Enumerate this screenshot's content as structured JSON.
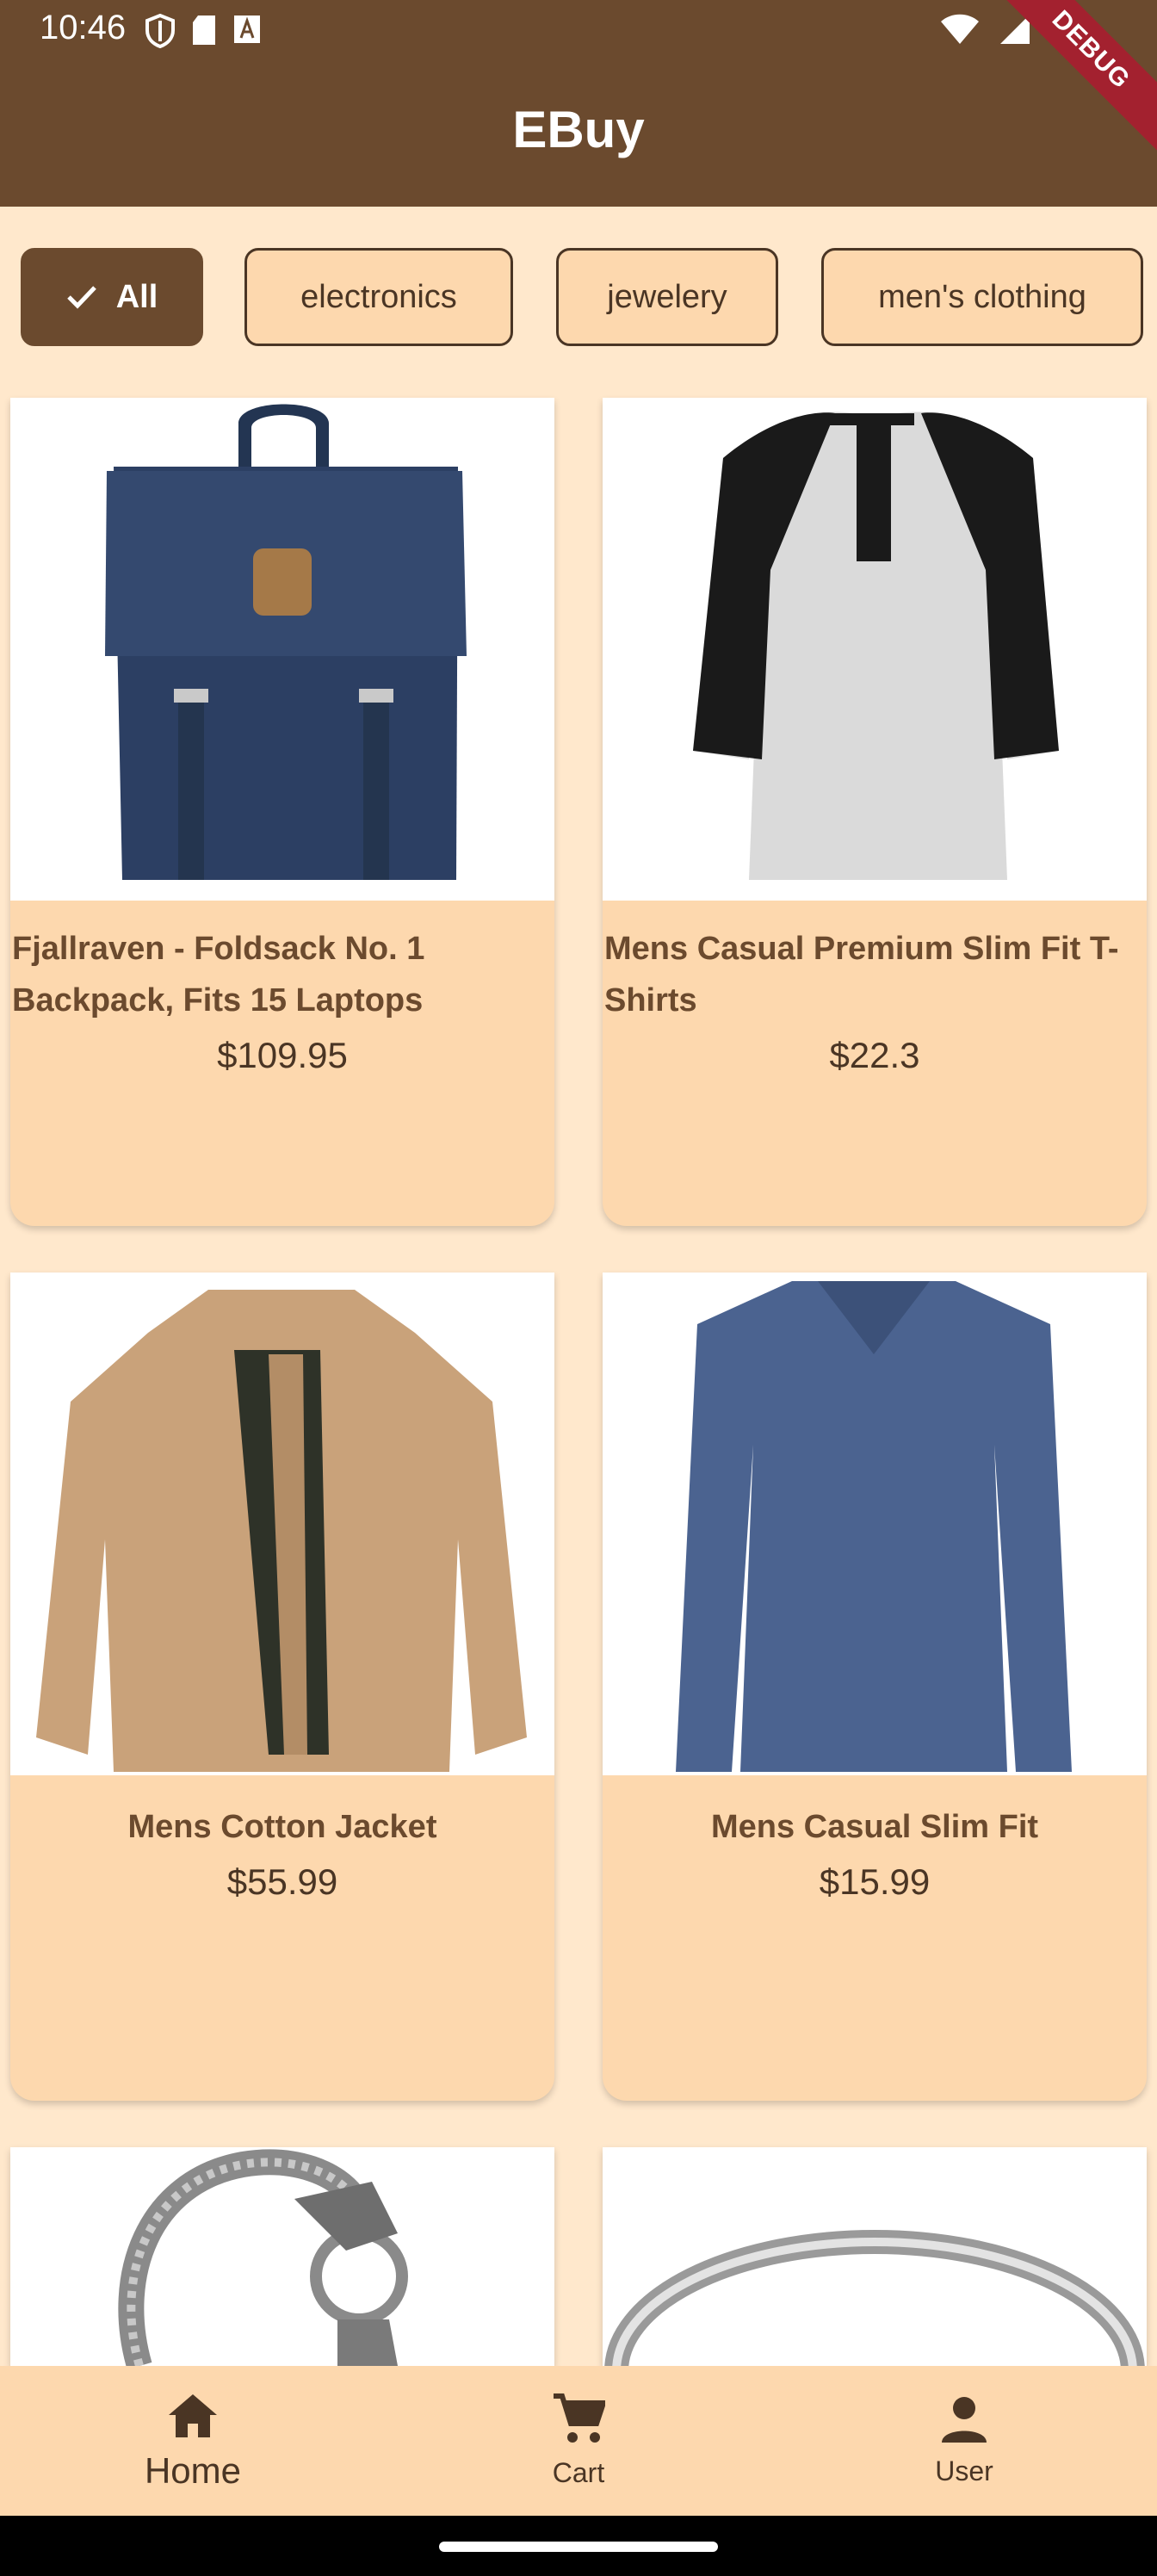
{
  "status_bar": {
    "time": "10:46"
  },
  "app_bar": {
    "title": "EBuy",
    "debug_banner": "DEBUG"
  },
  "categories": [
    {
      "label": "All",
      "selected": true
    },
    {
      "label": "electronics",
      "selected": false
    },
    {
      "label": "jewelery",
      "selected": false
    },
    {
      "label": "men's clothing",
      "selected": false
    }
  ],
  "products": [
    {
      "title": "Fjallraven - Foldsack No. 1 Backpack, Fits 15 Laptops",
      "price": "$109.95",
      "image": "backpack"
    },
    {
      "title": "Mens Casual Premium Slim Fit T-Shirts",
      "price": "$22.3",
      "image": "raglan-shirt"
    },
    {
      "title": "Mens Cotton Jacket",
      "price": "$55.99",
      "image": "jacket"
    },
    {
      "title": "Mens Casual Slim Fit",
      "price": "$15.99",
      "image": "longsleeve-shirt"
    },
    {
      "title": "",
      "price": "",
      "image": "dragon-bracelet"
    },
    {
      "title": "",
      "price": "",
      "image": "silver-ring"
    }
  ],
  "bottom_nav": [
    {
      "label": "Home",
      "icon": "home-icon",
      "active": true
    },
    {
      "label": "Cart",
      "icon": "cart-icon",
      "active": false
    },
    {
      "label": "User",
      "icon": "user-icon",
      "active": false
    }
  ],
  "colors": {
    "primary": "#6B4A2E",
    "surface": "#FDD8AE",
    "background": "#FFE8CC",
    "text": "#4A3524"
  }
}
